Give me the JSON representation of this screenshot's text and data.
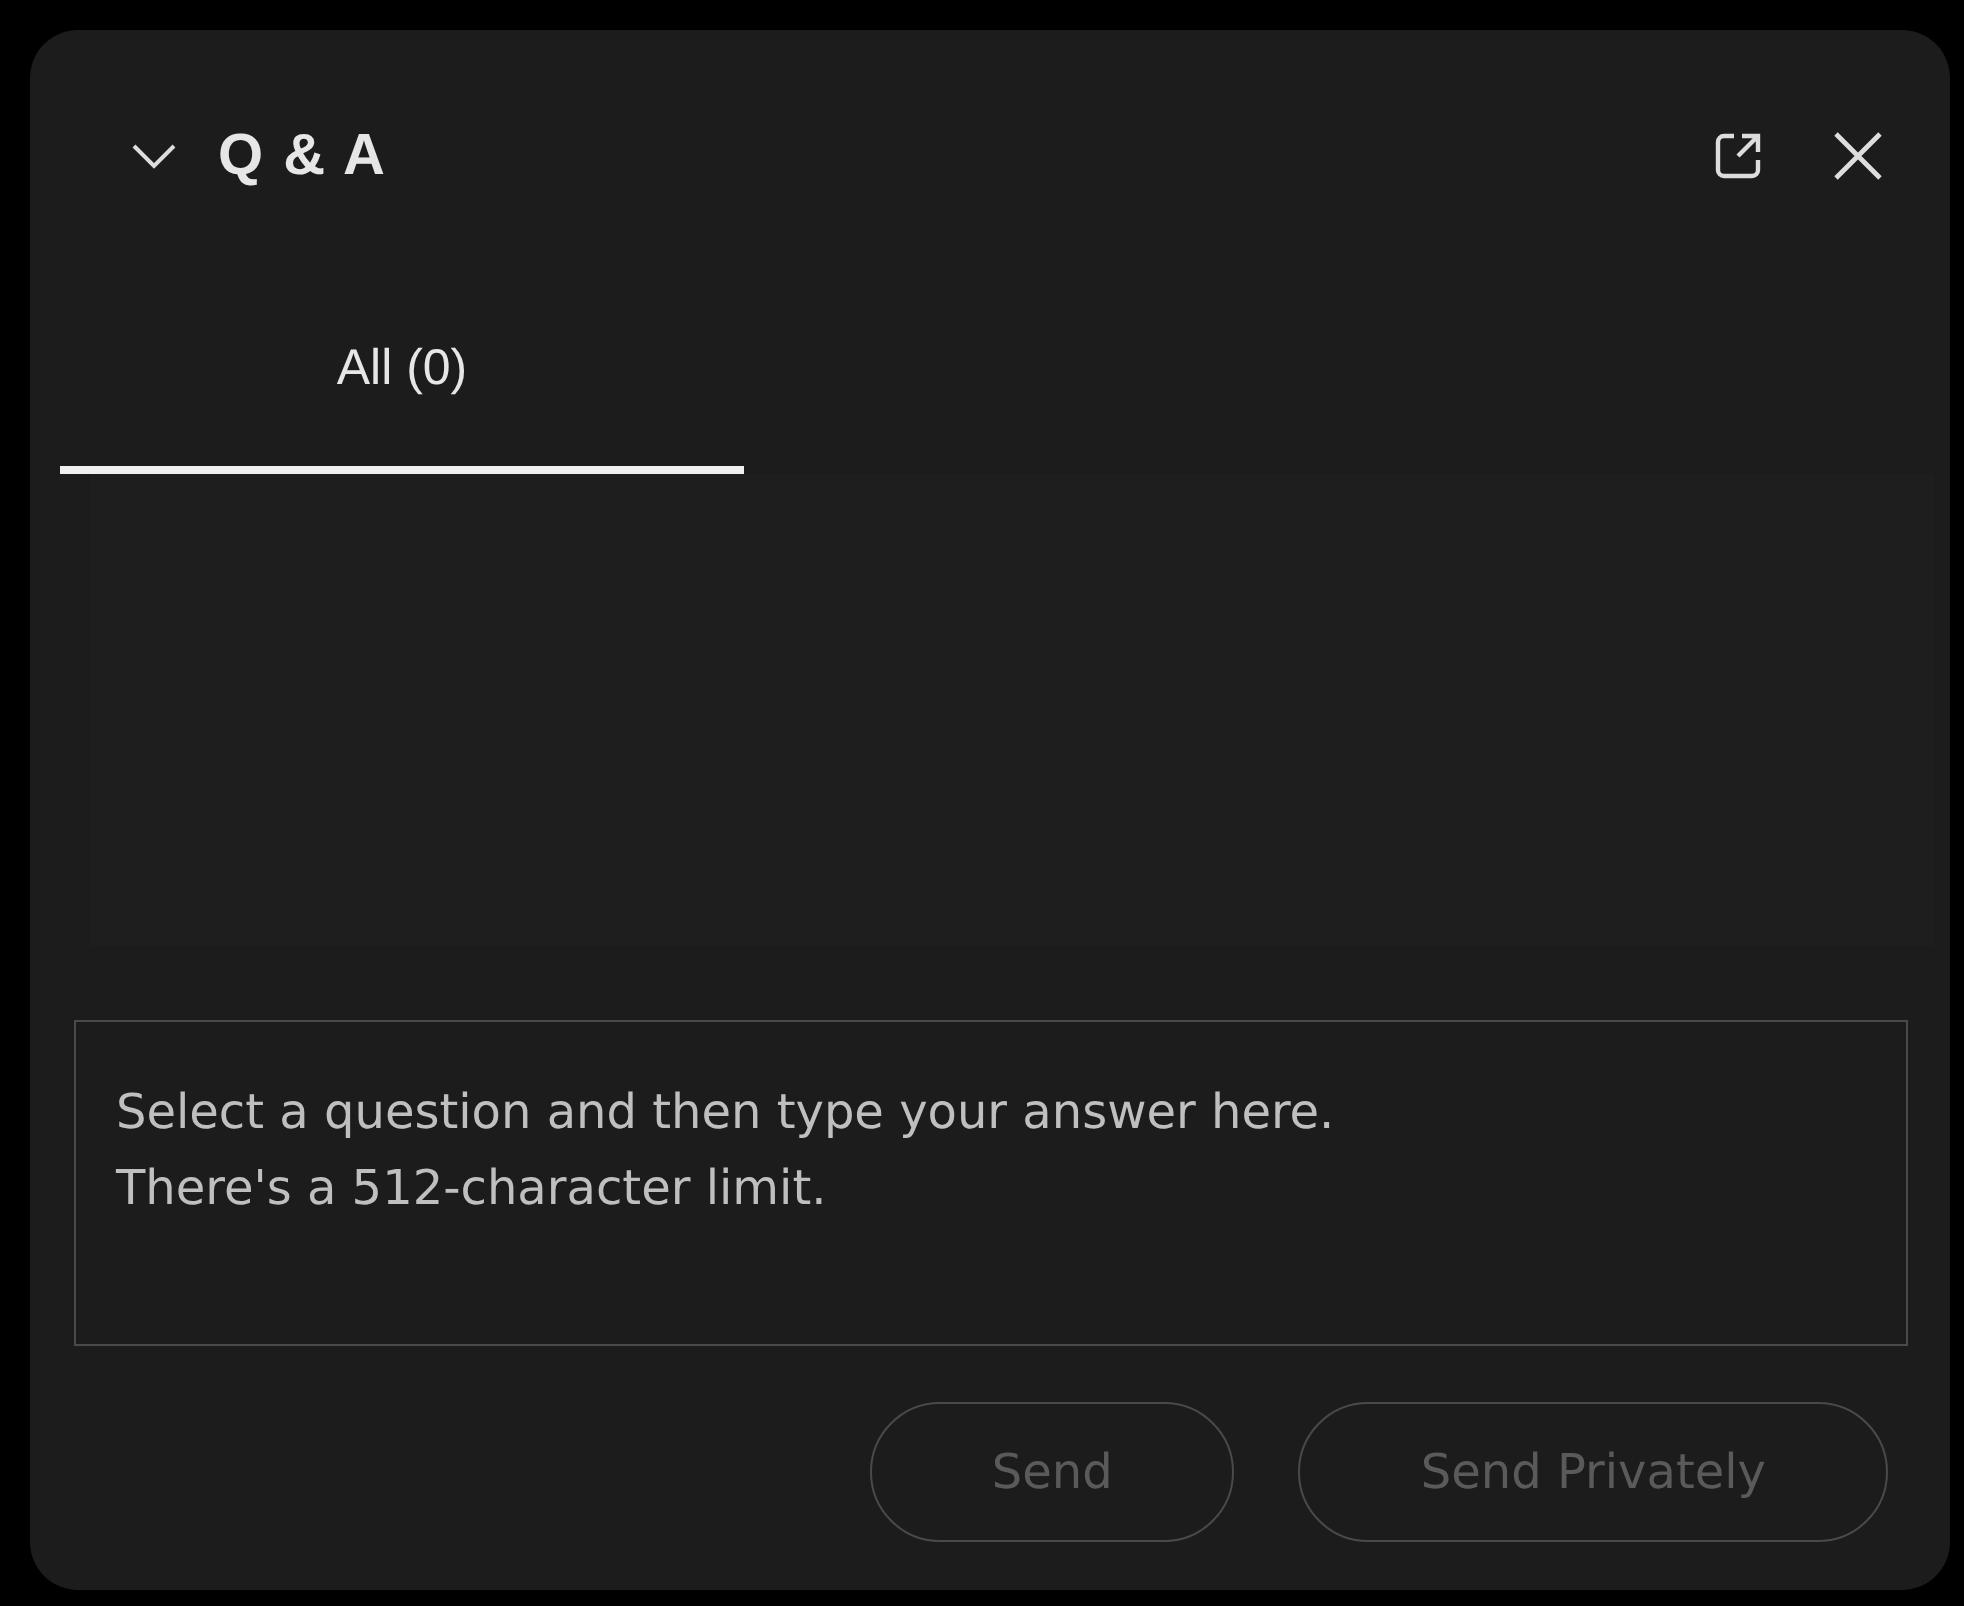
{
  "panel": {
    "title": "Q & A",
    "expanded": true
  },
  "tabs": [
    {
      "label": "All (0)",
      "selected": true
    }
  ],
  "answer_field": {
    "placeholder": "Select a question and then type your answer here.\nThere's a 512-character limit."
  },
  "buttons": [
    {
      "label": "Send",
      "disabled": true
    },
    {
      "label": "Send Privately",
      "disabled": true
    }
  ]
}
